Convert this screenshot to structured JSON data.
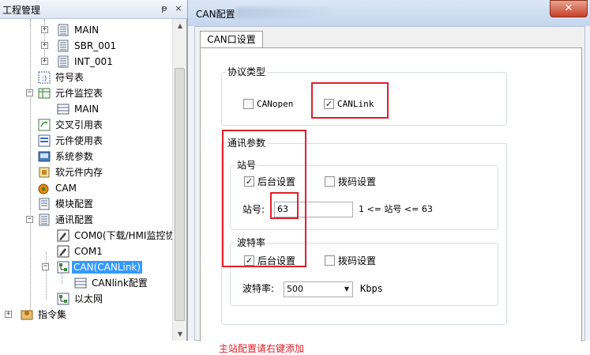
{
  "project_panel": {
    "title": "工程管理",
    "pin_glyph": "ᵽ",
    "close_glyph": "×",
    "tree": {
      "main": "MAIN",
      "sbr": "SBR_001",
      "int": "INT_001",
      "symbols": "符号表",
      "element_monitor": "元件监控表",
      "element_monitor_main": "MAIN",
      "cross_ref": "交叉引用表",
      "element_usage": "元件使用表",
      "system_params": "系统参数",
      "soft_memory": "软元件内存",
      "cam": "CAM",
      "module_config": "模块配置",
      "comm_config": "通讯配置",
      "com0": "COM0(下载/HMI监控协",
      "com1": "COM1",
      "can": "CAN(CANLink)",
      "canlink_config": "CANlink配置",
      "ethernet": "以太网",
      "instruction_set": "指令集"
    }
  },
  "dialog": {
    "title": "CAN配置",
    "close_glyph": "✕",
    "tab": "CAN口设置",
    "protocol": {
      "title": "协议类型",
      "canopen": {
        "label": "CANopen",
        "checked": false
      },
      "canlink": {
        "label": "CANLink",
        "checked": true
      }
    },
    "comm": {
      "title": "通讯参数",
      "station": {
        "title": "站号",
        "background": {
          "label": "后台设置",
          "checked": true
        },
        "dip": {
          "label": "拨码设置",
          "checked": false
        },
        "field_label": "站号:",
        "value": "63",
        "range_text": "1 <= 站号 <= 63"
      },
      "baud": {
        "title": "波特率",
        "background": {
          "label": "后台设置",
          "checked": true
        },
        "dip": {
          "label": "拨码设置",
          "checked": false
        },
        "field_label": "波特率:",
        "value": "500",
        "unit": "Kbps"
      }
    },
    "hint": "主站配置请右键添加"
  },
  "colors": {
    "highlight_box": "#e0202a",
    "selection": "#3399ff",
    "hint_text": "#e0202a"
  }
}
